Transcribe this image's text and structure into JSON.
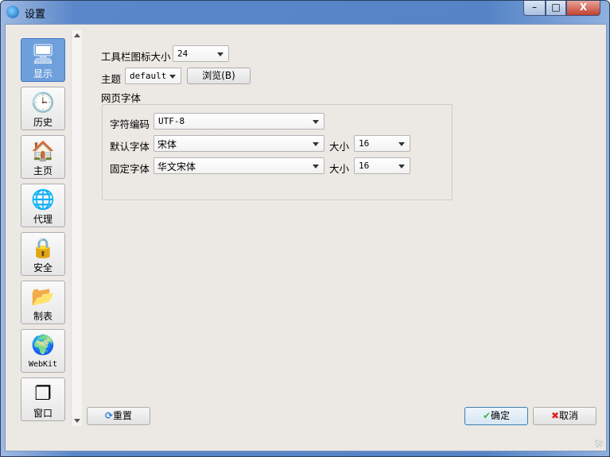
{
  "window": {
    "title": "设置",
    "minimize": "–",
    "maximize": "□",
    "close": "X"
  },
  "sidebar": {
    "items": [
      {
        "label": "显示",
        "icon": "monitor-icon",
        "glyph": "🖥",
        "selected": true
      },
      {
        "label": "历史",
        "icon": "clock-icon",
        "glyph": "🕒"
      },
      {
        "label": "主页",
        "icon": "home-icon",
        "glyph": "🏠"
      },
      {
        "label": "代理",
        "icon": "network-globe-icon",
        "glyph": "🌐"
      },
      {
        "label": "安全",
        "icon": "lock-icon",
        "glyph": "🔒"
      },
      {
        "label": "制表",
        "icon": "folder-icon",
        "glyph": "📂"
      },
      {
        "label": "WebKit",
        "icon": "webkit-globe-icon",
        "glyph": "🌍"
      },
      {
        "label": "窗口",
        "icon": "windows-icon",
        "glyph": "❐"
      }
    ]
  },
  "form": {
    "toolbar_icon_size_label": "工具栏图标大小",
    "toolbar_icon_size": "24",
    "theme_label": "主题",
    "theme": "default",
    "browse_label": "浏览(B)",
    "web_font_heading": "网页字体",
    "encoding_label": "字符编码",
    "encoding": "UTF-8",
    "default_font_label": "默认字体",
    "default_font": "宋体",
    "default_size_label": "大小",
    "default_size": "16",
    "fixed_font_label": "固定字体",
    "fixed_font": "华文宋体",
    "fixed_size_label": "大小",
    "fixed_size": "16"
  },
  "buttons": {
    "reset": "重置",
    "ok": "确定",
    "cancel": "取消"
  }
}
